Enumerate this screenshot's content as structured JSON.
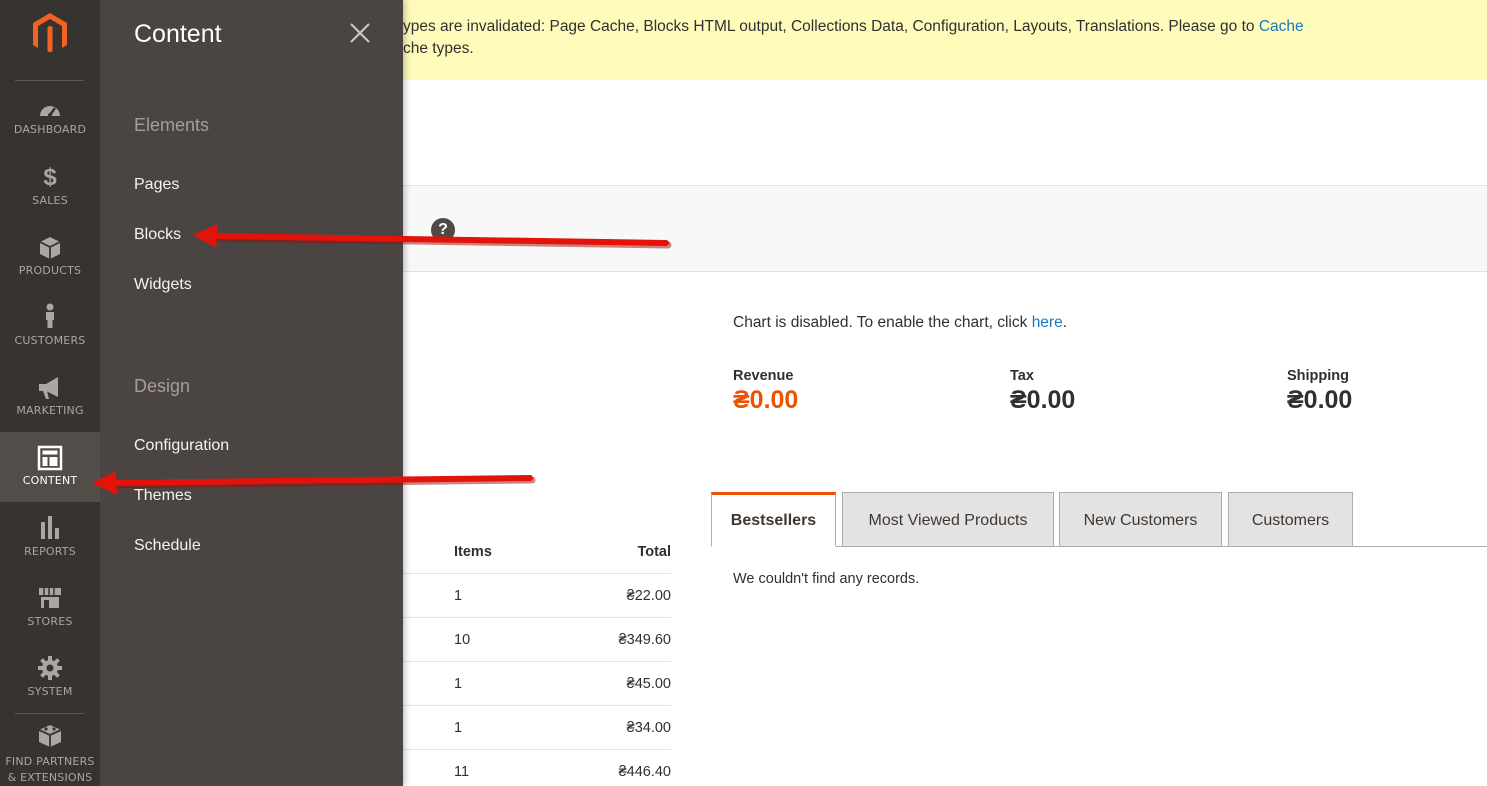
{
  "nav": {
    "items": [
      {
        "label": "DASHBOARD",
        "icon": "dashboard-icon"
      },
      {
        "label": "SALES",
        "icon": "dollar-icon"
      },
      {
        "label": "PRODUCTS",
        "icon": "box-icon"
      },
      {
        "label": "CUSTOMERS",
        "icon": "person-icon"
      },
      {
        "label": "MARKETING",
        "icon": "megaphone-icon"
      },
      {
        "label": "CONTENT",
        "icon": "layout-icon",
        "active": true
      },
      {
        "label": "REPORTS",
        "icon": "bar-chart-icon"
      },
      {
        "label": "STORES",
        "icon": "storefront-icon"
      },
      {
        "label": "SYSTEM",
        "icon": "gear-icon"
      },
      {
        "label_line1": "FIND PARTNERS",
        "label_line2": "& EXTENSIONS",
        "icon": "extension-box-icon"
      }
    ]
  },
  "flyout": {
    "title": "Content",
    "sections": [
      {
        "title": "Elements",
        "links": [
          "Pages",
          "Blocks",
          "Widgets"
        ]
      },
      {
        "title": "Design",
        "links": [
          "Configuration",
          "Themes",
          "Schedule"
        ]
      }
    ]
  },
  "notice": {
    "line1_text": "ypes are invalidated: Page Cache, Blocks HTML output, Collections Data, Configuration, Layouts, Translations. Please go to ",
    "line1_link": "Cache",
    "line2_text": "che types."
  },
  "dashboard": {
    "chart_msg_prefix": "Chart is disabled. To enable the chart, click ",
    "chart_msg_link": "here",
    "chart_msg_suffix": ".",
    "totals": [
      {
        "label": "Revenue",
        "value": "₴0.00"
      },
      {
        "label": "Tax",
        "value": "₴0.00"
      },
      {
        "label": "Shipping",
        "value": "₴0.00"
      }
    ],
    "orders": {
      "headers": {
        "items": "Items",
        "total": "Total"
      },
      "rows": [
        {
          "items": "1",
          "total": "₴22.00"
        },
        {
          "items": "10",
          "total": "₴349.60"
        },
        {
          "items": "1",
          "total": "₴45.00"
        },
        {
          "items": "1",
          "total": "₴34.00"
        },
        {
          "items": "11",
          "total": "₴446.40"
        }
      ]
    },
    "tabs": [
      "Bestsellers",
      "Most Viewed Products",
      "New Customers",
      "Customers"
    ],
    "no_records": "We couldn't find any records."
  },
  "colors": {
    "nav_bg": "#373330",
    "flyout_bg": "#4a4542",
    "accent": "#eb5202",
    "link": "#1979c3",
    "notice_bg": "#fffbbb",
    "arrow": "#e3120b"
  }
}
